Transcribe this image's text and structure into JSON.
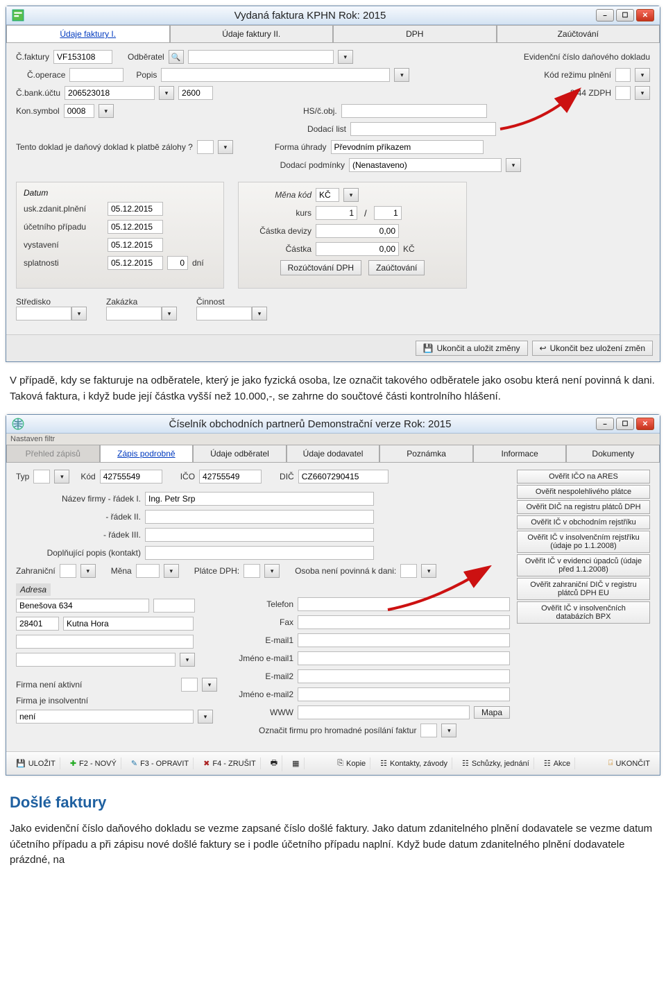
{
  "window1": {
    "title": "Vydaná faktura  KPHN  Rok: 2015",
    "tabs": [
      "Údaje faktury I.",
      "Údaje faktury II.",
      "DPH",
      "Zaúčtování"
    ],
    "cfaktury_lbl": "Č.faktury",
    "cfaktury_val": "VF153108",
    "odberatel_lbl": "Odběratel",
    "evid_lbl": "Evidenční číslo daňového dokladu",
    "coperace_lbl": "Č.operace",
    "popis_lbl": "Popis",
    "kodrezimu_lbl": "Kód režimu plnění",
    "cbank_lbl": "Č.bank.účtu",
    "cbank_val": "206523018",
    "cbank2_val": "2600",
    "s44_lbl": "§ 44 ZDPH",
    "konsymbol_lbl": "Kon.symbol",
    "konsymbol_val": "0008",
    "hscobj_lbl": "HS/č.obj.",
    "dodaci_lbl": "Dodací list",
    "tento_lbl": "Tento doklad je daňový doklad k platbě zálohy ?",
    "forma_lbl": "Forma úhrady",
    "forma_val": "Převodním příkazem",
    "dodpod_lbl": "Dodací podmínky",
    "dodpod_val": "(Nenastaveno)",
    "datum_legend": "Datum",
    "uskzdan_lbl": "usk.zdanit.plnění",
    "ucetpr_lbl": "účetního případu",
    "vystaveni_lbl": "vystavení",
    "splatnosti_lbl": "splatnosti",
    "dni_lbl": "dní",
    "date1": "05.12.2015",
    "date2": "05.12.2015",
    "date3": "05.12.2015",
    "date4": "05.12.2015",
    "dni_val": "0",
    "mena_legend": "Měna kód",
    "mena_val": "KČ",
    "kurs_lbl": "kurs",
    "kurs_v1": "1",
    "kurs_v2": "1",
    "castka_dev_lbl": "Částka devizy",
    "castka_dev_val": "0,00",
    "castka_lbl": "Částka",
    "castka_val": "0,00",
    "kc": "KČ",
    "rozuct_btn": "Rozúčtování DPH",
    "zauct_btn": "Zaúčtování",
    "stredisko_lbl": "Středisko",
    "zakazka_lbl": "Zakázka",
    "cinnost_lbl": "Činnost",
    "save_btn": "Ukončit a uložit změny",
    "cancel_btn": "Ukončit bez uložení změn"
  },
  "para1": "V případě, kdy se fakturuje na odběratele, který je jako fyzická osoba, lze označit takového odběratele jako osobu která není povinná k dani. Taková faktura, i když bude její částka vyšší než 10.000,-, se zahrne do součtové části kontrolního hlášení.",
  "window2": {
    "title": "Číselník obchodních partnerů  Demonstrační verze  Rok: 2015",
    "filter_lbl": "Nastaven filtr",
    "tabs": [
      "Přehled zápisů",
      "Zápis podrobně",
      "Údaje odběratel",
      "Údaje dodavatel",
      "Poznámka",
      "Informace",
      "Dokumenty"
    ],
    "typ_lbl": "Typ",
    "kod_lbl": "Kód",
    "kod_val": "42755549",
    "ico_lbl": "IČO",
    "ico_val": "42755549",
    "dic_lbl": "DIČ",
    "dic_val": "CZ6607290415",
    "nazev1_lbl": "Název firmy - řádek I.",
    "nazev1_val": "Ing. Petr Srp",
    "nazev2_lbl": "- řádek II.",
    "nazev3_lbl": "- řádek III.",
    "dopl_lbl": "Doplňující popis (kontakt)",
    "zahr_lbl": "Zahraniční",
    "mena_lbl": "Měna",
    "platce_lbl": "Plátce DPH:",
    "osoba_lbl": "Osoba není povinná k dani:",
    "adresa_legend": "Adresa",
    "addr_street": "Benešova 634",
    "addr_zip": "28401",
    "addr_city": "Kutna Hora",
    "telefon_lbl": "Telefon",
    "fax_lbl": "Fax",
    "email1_lbl": "E-mail1",
    "jmeno1_lbl": "Jméno e-mail1",
    "email2_lbl": "E-mail2",
    "jmeno2_lbl": "Jméno e-mail2",
    "www_lbl": "WWW",
    "mapa_btn": "Mapa",
    "firma_akt_lbl": "Firma není aktivní",
    "firma_ins_lbl": "Firma je insolventní",
    "neni_val": "není",
    "oznacit_lbl": "Označit firmu pro hromadné posílání faktur",
    "sidebtns": [
      "Ověřit IČO na ARES",
      "Ověřit nespolehlivého plátce",
      "Ověřit DIČ na registru plátců DPH",
      "Ověřit IČ v obchodním rejstříku",
      "Ověřit IČ v insolvenčním rejstříku (údaje po 1.1.2008)",
      "Ověřit IČ v evidenci úpadců (údaje před 1.1.2008)",
      "Ověřit zahraniční DIČ v registru plátců DPH EU",
      "Ověřit IČ v insolvenčních databázích BPX"
    ],
    "toolbar": {
      "ulozit": "ULOŽIT",
      "f2": "F2 - NOVÝ",
      "f3": "F3 - OPRAVIT",
      "f4": "F4 - ZRUŠIT",
      "kopie": "Kopie",
      "kontakty": "Kontakty, závody",
      "schuzky": "Schůzky, jednání",
      "akce": "Akce",
      "ukoncit": "UKONČIT"
    }
  },
  "h2": "Došlé faktury",
  "para2": "Jako evidenční číslo daňového dokladu se vezme zapsané číslo došlé faktury. Jako datum zdanitelného plnění dodavatele se vezme datum účetního případu a při zápisu nové došlé faktury se i podle účetního případu naplní. Když bude datum zdanitelného plnění dodavatele prázdné, na"
}
